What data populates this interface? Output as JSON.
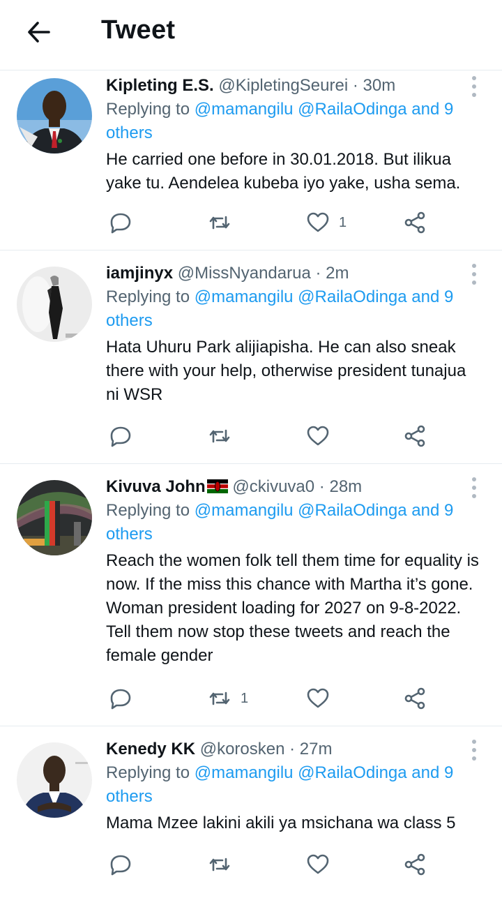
{
  "header": {
    "title": "Tweet",
    "back_icon": "arrow-left-icon"
  },
  "tweets": [
    {
      "name": "Kipleting E.S.",
      "handle": "@KipletingSeurei",
      "separator": "·",
      "time": "30m",
      "replying_prefix": "Replying to",
      "replying_mentions": "@mamangilu @RailaOdinga and 9 others",
      "text": "He carried one before in 30.01.2018. But ilikua yake tu. Aendelea kubeba iyo yake, usha sema.",
      "reply_count": "",
      "retweet_count": "",
      "like_count": "1"
    },
    {
      "name": "iamjinyx",
      "handle": "@MissNyandarua",
      "separator": "·",
      "time": "2m",
      "replying_prefix": "Replying to",
      "replying_mentions": "@mamangilu @RailaOdinga and 9 others",
      "text": "Hata Uhuru Park alijiapisha. He can also sneak there with your help, otherwise president tunajua ni WSR",
      "reply_count": "",
      "retweet_count": "",
      "like_count": ""
    },
    {
      "name": "Kivuva John",
      "handle": "@ckivuva0",
      "separator": "·",
      "time": "28m",
      "replying_prefix": "Replying to",
      "replying_mentions": "@mamangilu @RailaOdinga and 9 others",
      "text": "Reach the women folk tell them time for equality is now. If the miss this chance with Martha it’s gone. Woman president loading for 2027 on 9-8-2022. Tell them now stop these tweets and reach the female gender",
      "reply_count": "",
      "retweet_count": "1",
      "like_count": ""
    },
    {
      "name": "Kenedy KK",
      "handle": "@korosken",
      "separator": "·",
      "time": "27m",
      "replying_prefix": "Replying to",
      "replying_mentions": "@mamangilu @RailaOdinga and 9 others",
      "text": "Mama Mzee lakini akili ya msichana wa class 5",
      "reply_count": "",
      "retweet_count": "",
      "like_count": ""
    }
  ],
  "colors": {
    "link": "#1d9bf0",
    "secondary": "#536471",
    "divider": "#e6ecf0"
  }
}
